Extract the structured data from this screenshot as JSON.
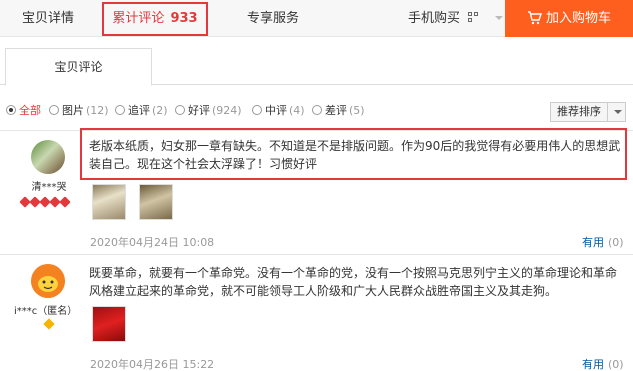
{
  "topbar": {
    "tab_detail": "宝贝详情",
    "tab_reviews": "累计评论",
    "tab_reviews_count": "933",
    "tab_service": "专享服务",
    "tab_mobile": "手机购买",
    "cart_button": "加入购物车",
    "cart_color": "#ff5f1e",
    "accent_color": "#e4393c"
  },
  "subtab": {
    "label": "宝贝评论"
  },
  "filters": [
    {
      "label": "全部",
      "count": "",
      "selected": true
    },
    {
      "label": "图片",
      "count": "(12)",
      "selected": false
    },
    {
      "label": "追评",
      "count": "(2)",
      "selected": false
    },
    {
      "label": "好评",
      "count": "(924)",
      "selected": false
    },
    {
      "label": "中评",
      "count": "(4)",
      "selected": false
    },
    {
      "label": "差评",
      "count": "(5)",
      "selected": false
    }
  ],
  "sort": {
    "label": "推荐排序"
  },
  "reviews": [
    {
      "user": "清***哭",
      "text": "老版本纸质，妇女那一章有缺失。不知道是不是排版问题。作为90后的我觉得有必要用伟人的思想武装自己。现在这个社会太浮躁了！习惯好评",
      "date": "2020年04月24日 10:08",
      "useful_label": "有用",
      "useful_count": "(0)"
    },
    {
      "user": "i***c（匿名）",
      "text": "既要革命，就要有一个革命党。没有一个革命的党，没有一个按照马克思列宁主义的革命理论和革命风格建立起来的革命党，就不可能领导工人阶级和广大人民群众战胜帝国主义及其走狗。",
      "date": "2020年04月26日 15:22",
      "useful_label": "有用",
      "useful_count": "(0)"
    }
  ]
}
